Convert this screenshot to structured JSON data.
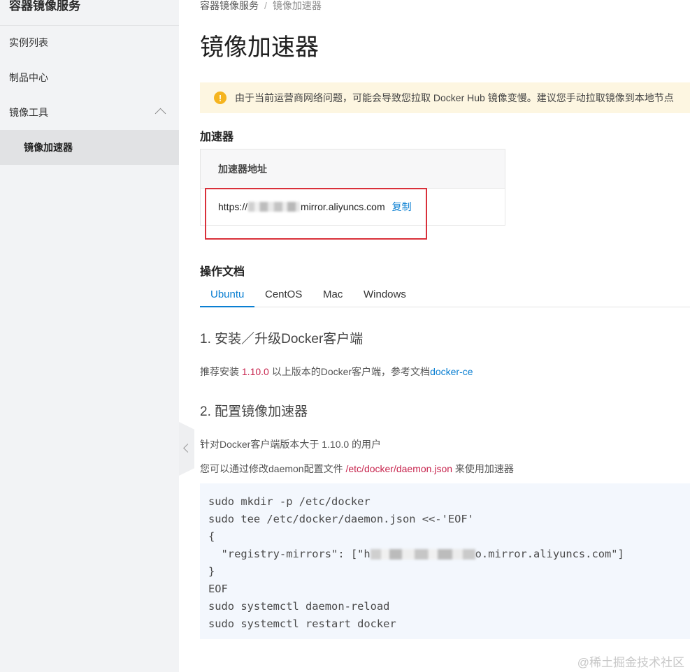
{
  "sidebar": {
    "title": "容器镜像服务",
    "items": [
      {
        "label": "实例列表"
      },
      {
        "label": "制品中心"
      },
      {
        "label": "镜像工具"
      },
      {
        "label": "镜像加速器"
      }
    ]
  },
  "breadcrumb": {
    "root": "容器镜像服务",
    "separator": "/",
    "current": "镜像加速器"
  },
  "page": {
    "title": "镜像加速器"
  },
  "notice": {
    "icon": "warning-icon",
    "text": "由于当前运营商网络问题，可能会导致您拉取 Docker Hub 镜像变慢。建议您手动拉取镜像到本地节点"
  },
  "accelerator": {
    "heading": "加速器",
    "column_header": "加速器地址",
    "url_prefix": "https://",
    "url_suffix": "mirror.aliyuncs.com",
    "copy_label": "复制"
  },
  "docs": {
    "heading": "操作文档",
    "tabs": [
      {
        "label": "Ubuntu",
        "active": true
      },
      {
        "label": "CentOS",
        "active": false
      },
      {
        "label": "Mac",
        "active": false
      },
      {
        "label": "Windows",
        "active": false
      }
    ],
    "step1": {
      "title": "1. 安装／升级Docker客户端",
      "text_before": "推荐安装 ",
      "version": "1.10.0",
      "text_middle": " 以上版本的Docker客户端，参考文档",
      "link": "docker-ce"
    },
    "step2": {
      "title": "2. 配置镜像加速器",
      "line1": "针对Docker客户端版本大于 1.10.0 的用户",
      "line2_before": "您可以通过修改daemon配置文件 ",
      "config_path": "/etc/docker/daemon.json",
      "line2_after": " 来使用加速器"
    },
    "code": {
      "l1": "sudo mkdir -p /etc/docker",
      "l2": "sudo tee /etc/docker/daemon.json <<-'EOF'",
      "l3": "{",
      "l4_before": "  \"registry-mirrors\": [\"h",
      "l4_after": "o.mirror.aliyuncs.com\"]",
      "l5": "}",
      "l6": "EOF",
      "l7": "sudo systemctl daemon-reload",
      "l8": "sudo systemctl restart docker"
    }
  },
  "watermark": "@稀土掘金技术社区",
  "colors": {
    "accent": "#0a7fd2",
    "highlight_box": "#d9303a",
    "notice_bg": "#fdf6e1",
    "code_bg": "#f3f7fd"
  }
}
